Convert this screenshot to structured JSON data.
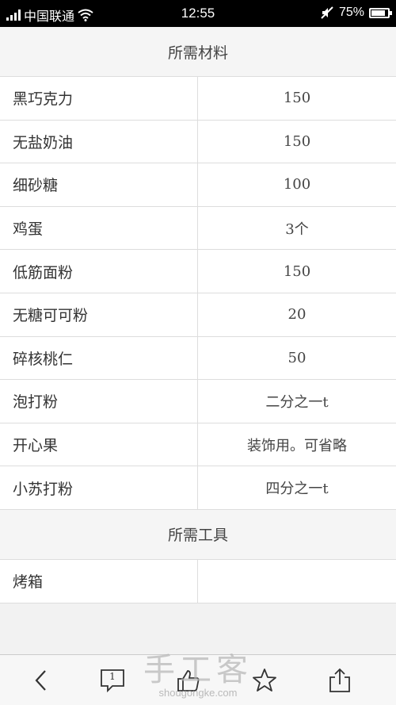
{
  "status_bar": {
    "carrier": "中国联通",
    "time": "12:55",
    "battery": "75%",
    "battery_level": 0.75
  },
  "materials": {
    "header": "所需材料",
    "rows": [
      {
        "name": "黑巧克力",
        "amount": "150"
      },
      {
        "name": "无盐奶油",
        "amount": "150"
      },
      {
        "name": "细砂糖",
        "amount": "100"
      },
      {
        "name": "鸡蛋",
        "amount": "3个"
      },
      {
        "name": "低筋面粉",
        "amount": "150"
      },
      {
        "name": "无糖可可粉",
        "amount": "20"
      },
      {
        "name": "碎核桃仁",
        "amount": "50"
      },
      {
        "name": "泡打粉",
        "amount": "二分之一t"
      },
      {
        "name": "开心果",
        "amount": "装饰用。可省略"
      },
      {
        "name": "小苏打粉",
        "amount": "四分之一t"
      }
    ]
  },
  "tools": {
    "header": "所需工具",
    "rows": [
      {
        "name": "烤箱",
        "amount": ""
      }
    ]
  },
  "bottom_bar": {
    "comment_count": "1",
    "icons": [
      "back-icon",
      "comment-icon",
      "like-icon",
      "star-icon",
      "share-icon"
    ]
  },
  "watermark": {
    "main": "手工客",
    "sub": "shougongke.com"
  }
}
